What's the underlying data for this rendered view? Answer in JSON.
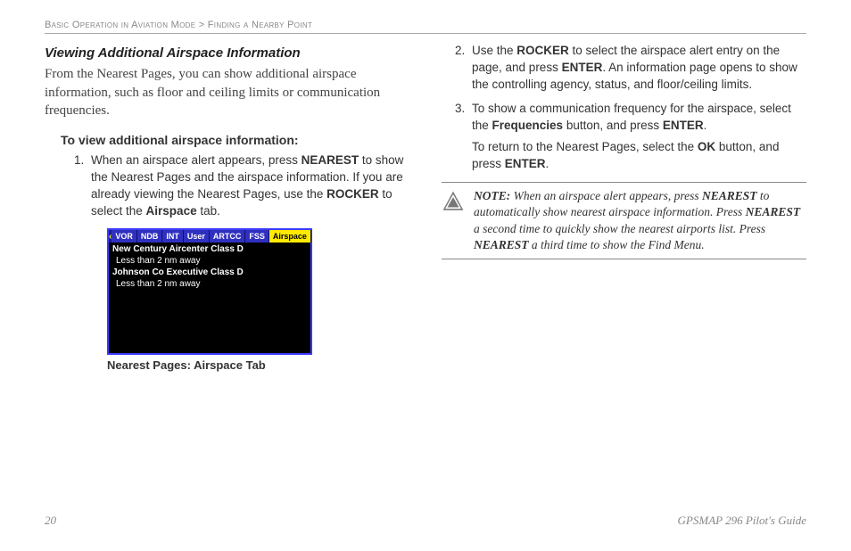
{
  "header": {
    "breadcrumb_a": "Basic Operation in Aviation Mode",
    "sep": " > ",
    "breadcrumb_b": "Finding a Nearby Point"
  },
  "section": {
    "title": "Viewing Additional Airspace Information",
    "intro": "From the Nearest Pages, you can show additional airspace information, such as floor and ceiling limits or communication frequencies.",
    "howto": "To view additional airspace information:"
  },
  "steps_left": {
    "s1_a": "When an airspace alert appears, press ",
    "s1_b": "NEAREST",
    "s1_c": " to show the Nearest Pages and the airspace information. If you are already viewing the Nearest Pages, use the ",
    "s1_d": "ROCKER",
    "s1_e": " to select the ",
    "s1_f": "Airspace",
    "s1_g": " tab."
  },
  "device": {
    "tabs": [
      "VOR",
      "NDB",
      "INT",
      "User",
      "ARTCC",
      "FSS",
      "Airspace"
    ],
    "selected_index": 6,
    "entries": [
      {
        "name": "New Century Aircenter Class D",
        "dist": "Less than 2 nm away"
      },
      {
        "name": "Johnson Co Executive Class D",
        "dist": "Less than 2 nm away"
      }
    ],
    "caption": "Nearest Pages: Airspace Tab"
  },
  "steps_right": {
    "s2_a": "Use the ",
    "s2_b": "ROCKER",
    "s2_c": " to select the airspace alert entry on the page, and press ",
    "s2_d": "ENTER",
    "s2_e": ". An information page opens to show the controlling agency, status, and floor/ceiling limits.",
    "s3_a": "To show a communication frequency for the airspace, select the ",
    "s3_b": "Frequencies",
    "s3_c": " button, and press ",
    "s3_d": "ENTER",
    "s3_e": ".",
    "s3_f": "To return to the Nearest Pages, select the ",
    "s3_g": "OK",
    "s3_h": " button, and press ",
    "s3_i": "ENTER",
    "s3_j": "."
  },
  "note": {
    "label": "NOTE:",
    "a": " When an airspace alert appears, press ",
    "b": "NEAREST",
    "c": " to automatically show nearest airspace information. Press ",
    "d": "NEAREST",
    "e": " a second time to quickly show the nearest airports list. Press ",
    "f": "NEAREST",
    "g": " a third time to show the Find Menu."
  },
  "footer": {
    "page": "20",
    "guide": "GPSMAP 296 Pilot's Guide"
  }
}
